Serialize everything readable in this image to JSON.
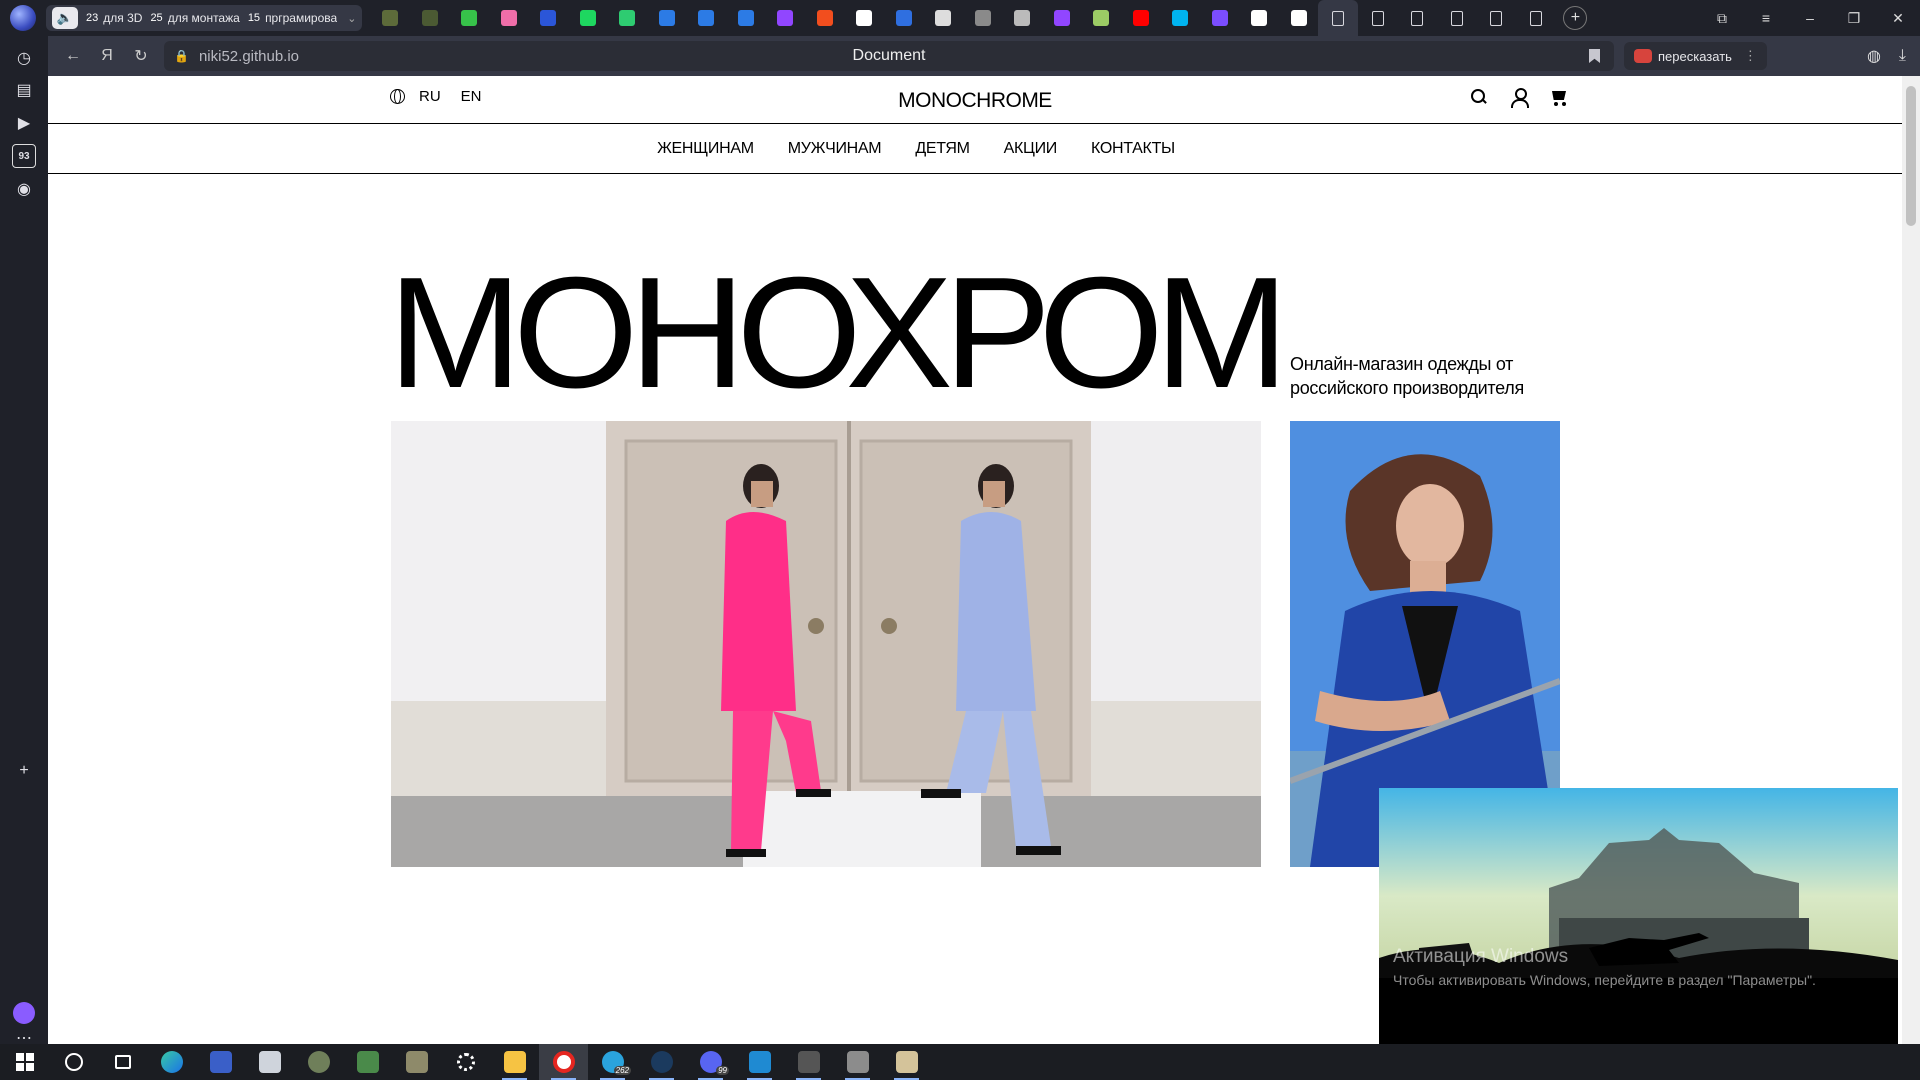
{
  "browser": {
    "tab_groups": [
      {
        "count": "23",
        "name": "для 3D"
      },
      {
        "count": "25",
        "name": "для монтажа"
      },
      {
        "count": "15",
        "name": "прграмирова"
      }
    ],
    "tab_favicons": [
      {
        "name": "tank-icon",
        "color": "#5d6b3a"
      },
      {
        "name": "tank-icon-2",
        "color": "#4b5a33"
      },
      {
        "name": "chart-bars-icon",
        "color": "#37c24a"
      },
      {
        "name": "balloon-icon",
        "color": "#f06ea9"
      },
      {
        "name": "planet-icon",
        "color": "#2b56d8"
      },
      {
        "name": "k-icon",
        "color": "#1ed760"
      },
      {
        "name": "g-circle-icon",
        "color": "#2ecc71"
      },
      {
        "name": "f-icon",
        "color": "#2c7be5"
      },
      {
        "name": "f-icon-2",
        "color": "#2c7be5"
      },
      {
        "name": "f-icon-3",
        "color": "#2c7be5"
      },
      {
        "name": "twitch-icon",
        "color": "#9146ff"
      },
      {
        "name": "figma-icon",
        "color": "#f24e1e"
      },
      {
        "name": "patreon-icon",
        "color": "#ffffff"
      },
      {
        "name": "mail-icon",
        "color": "#2f6fe0"
      },
      {
        "name": "audio-icon",
        "color": "#dddddd"
      },
      {
        "name": "shield-icon",
        "color": "#8a8a8a"
      },
      {
        "name": "shield-icon-2",
        "color": "#bbbbbb"
      },
      {
        "name": "twitch-icon-2",
        "color": "#9146ff"
      },
      {
        "name": "avatar-icon",
        "color": "#9ccc65"
      },
      {
        "name": "youtube-icon",
        "color": "#ff0000"
      },
      {
        "name": "blue-app-icon",
        "color": "#00b4f0"
      },
      {
        "name": "list-icon",
        "color": "#7b4dff"
      },
      {
        "name": "github-icon",
        "color": "#ffffff"
      },
      {
        "name": "github-icon-2",
        "color": "#ffffff"
      }
    ],
    "url": "niki52.github.io",
    "page_title": "Document",
    "retell_label": "пересказать",
    "left_panel_badge": "93"
  },
  "site": {
    "lang_ru": "RU",
    "lang_en": "EN",
    "brand": "MONOCHROME",
    "nav": [
      "ЖЕНЩИНАМ",
      "МУЖЧИНАМ",
      "ДЕТЯМ",
      "АКЦИИ",
      "КОНТАКТЫ"
    ],
    "hero_title": "МОНОХРОМ",
    "hero_subtitle": "Онлайн-магазин одежды от российского произвордителя"
  },
  "overlay": {
    "activation_title": "Активация Windows",
    "activation_sub": "Чтобы активировать Windows, перейдите в раздел \"Параметры\"."
  },
  "taskbar": {
    "telegram_badge": "262",
    "discord_badge": "99"
  },
  "colors": {
    "accent_pink": "#ff2e88",
    "accent_lilac": "#9fb2e6",
    "accent_blue": "#2b4fb0"
  }
}
